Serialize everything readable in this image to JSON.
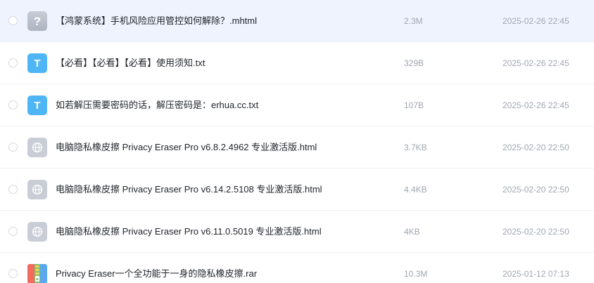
{
  "files": [
    {
      "name": "【鸿蒙系统】手机风险应用管控如何解除？.mhtml",
      "size": "2.3M",
      "date": "2025-02-26 22:45",
      "icon": "unknown-file-icon",
      "icon_glyph": "?",
      "selected": true
    },
    {
      "name": "【必看】【必看】【必看】使用须知.txt",
      "size": "329B",
      "date": "2025-02-26 22:45",
      "icon": "text-file-icon",
      "icon_glyph": "T",
      "selected": false
    },
    {
      "name": "如若解压需要密码的话，解压密码是：erhua.cc.txt",
      "size": "107B",
      "date": "2025-02-26 22:45",
      "icon": "text-file-icon",
      "icon_glyph": "T",
      "selected": false
    },
    {
      "name": "电脑隐私橡皮擦 Privacy Eraser Pro v6.8.2.4962 专业激活版.html",
      "size": "3.7KB",
      "date": "2025-02-20 22:50",
      "icon": "globe-icon",
      "selected": false
    },
    {
      "name": "电脑隐私橡皮擦 Privacy Eraser Pro v6.14.2.5108 专业激活版.html",
      "size": "4.4KB",
      "date": "2025-02-20 22:50",
      "icon": "globe-icon",
      "selected": false
    },
    {
      "name": "电脑隐私橡皮擦 Privacy Eraser Pro v6.11.0.5019 专业激活版.html",
      "size": "4KB",
      "date": "2025-02-20 22:50",
      "icon": "globe-icon",
      "selected": false
    },
    {
      "name": "Privacy Eraser一个全功能于一身的隐私橡皮擦.rar",
      "size": "10.3M",
      "date": "2025-01-12 07:13",
      "icon": "archive-icon",
      "selected": false
    }
  ],
  "colors": {
    "selected_row": "#eef3fe",
    "text_primary": "#1f2329",
    "text_secondary": "#a0a6b0",
    "txt_icon": "#4fb6f5",
    "html_icon": "#c9cdd6"
  }
}
